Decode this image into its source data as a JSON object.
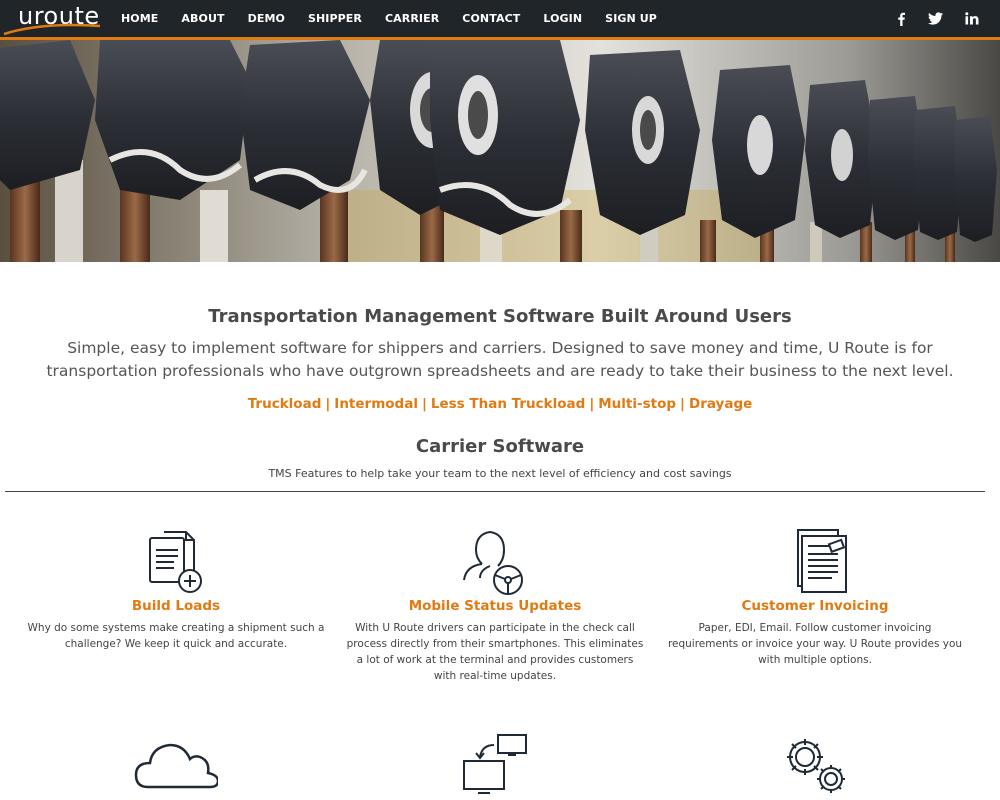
{
  "brand": {
    "logo_text": "uroute"
  },
  "nav": {
    "items": [
      {
        "label": "HOME"
      },
      {
        "label": "ABOUT"
      },
      {
        "label": "DEMO"
      },
      {
        "label": "SHIPPER"
      },
      {
        "label": "CARRIER"
      },
      {
        "label": "CONTACT"
      },
      {
        "label": "LOGIN"
      },
      {
        "label": "SIGN UP"
      }
    ],
    "social": [
      "facebook-icon",
      "twitter-icon",
      "linkedin-icon"
    ]
  },
  "colors": {
    "nav_bg": "#1f2528",
    "accent": "#e07a12",
    "text": "#4a4a4a"
  },
  "hero": {
    "image": "industrial-machine-parts-photo"
  },
  "main": {
    "headline": "Transportation Management Software Built Around Users",
    "intro": "Simple, easy to implement software for shippers and carriers. Designed to save money and time, U Route is for transportation professionals who have outgrown spreadsheets and are ready to take their business to the next level.",
    "modes": [
      "Truckload",
      "Intermodal",
      "Less Than Truckload",
      "Multi-stop",
      "Drayage"
    ],
    "section_title": "Carrier Software",
    "section_subtitle": "TMS Features to help take your team to the next level of efficiency and cost savings"
  },
  "features": [
    {
      "icon": "document-add-icon",
      "title": "Build Loads",
      "description": "Why do some systems make creating a shipment such a challenge? We keep it quick and accurate."
    },
    {
      "icon": "driver-wheel-icon",
      "title": "Mobile Status Updates",
      "description": "With U Route drivers can participate in the check call process directly from their smartphones. This eliminates a lot of work at the terminal and provides customers with real-time updates."
    },
    {
      "icon": "invoice-icon",
      "title": "Customer Invoicing",
      "description": "Paper, EDI, Email. Follow customer invoicing requirements or invoice your way. U Route provides you with multiple options."
    },
    {
      "icon": "cloud-icon"
    },
    {
      "icon": "computer-sync-icon"
    },
    {
      "icon": "gears-icon"
    }
  ]
}
